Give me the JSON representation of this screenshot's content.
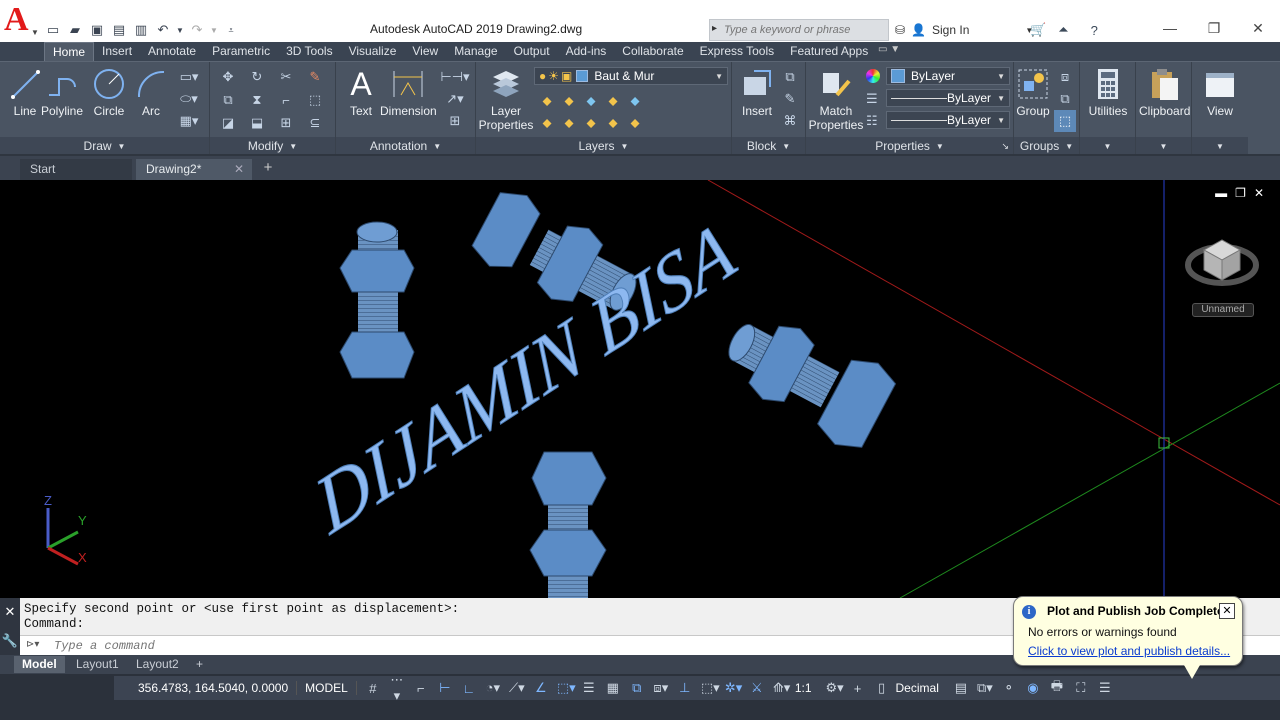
{
  "app": {
    "title": "Autodesk AutoCAD 2019    Drawing2.dwg",
    "logo_letter": "A",
    "search_placeholder": "Type a keyword or phrase",
    "sign_in": "Sign In"
  },
  "ribbon_tabs": [
    "Home",
    "Insert",
    "Annotate",
    "Parametric",
    "3D Tools",
    "Visualize",
    "View",
    "Manage",
    "Output",
    "Add-ins",
    "Collaborate",
    "Express Tools",
    "Featured Apps"
  ],
  "ribbon": {
    "draw": {
      "title": "Draw",
      "line": "Line",
      "polyline": "Polyline",
      "circle": "Circle",
      "arc": "Arc"
    },
    "modify": {
      "title": "Modify"
    },
    "annotation": {
      "title": "Annotation",
      "text": "Text",
      "dimension": "Dimension"
    },
    "layers": {
      "title": "Layers",
      "layer_properties_1": "Layer",
      "layer_properties_2": "Properties",
      "current_layer": "Baut & Mur"
    },
    "block": {
      "title": "Block",
      "insert": "Insert"
    },
    "properties": {
      "title": "Properties",
      "match_1": "Match",
      "match_2": "Properties",
      "color": "ByLayer",
      "linetype": "ByLayer",
      "lineweight": "ByLayer"
    },
    "groups": {
      "title": "Groups",
      "group": "Group"
    },
    "utilities": "Utilities",
    "clipboard": "Clipboard",
    "view": "View"
  },
  "file_tabs": {
    "start": "Start",
    "drawing": "Drawing2*"
  },
  "viewport": {
    "drawing_text": "DIJAMIN BISA",
    "viewcube_label": "Unnamed",
    "ucs": {
      "x": "X",
      "y": "Y",
      "z": "Z"
    }
  },
  "command": {
    "history_1": "Specify second point or <use first point as displacement>:",
    "history_2": "Command:",
    "placeholder": "Type a command"
  },
  "layout_tabs": [
    "Model",
    "Layout1",
    "Layout2"
  ],
  "status": {
    "coords": "356.4783, 164.5040, 0.0000",
    "model": "MODEL",
    "scale": "1:1",
    "units": "Decimal"
  },
  "notification": {
    "title": "Plot and Publish Job Complete",
    "message": "No errors or warnings found",
    "link": "Click to view plot and publish details..."
  },
  "colors": {
    "ribbon_bg": "#4a5462",
    "bolt_fill": "#5b8cc6",
    "text_fill": "#8db8f0",
    "axis_x": "#b31b1b",
    "axis_y": "#1f8a1f",
    "axis_z": "#1b2d9c"
  }
}
